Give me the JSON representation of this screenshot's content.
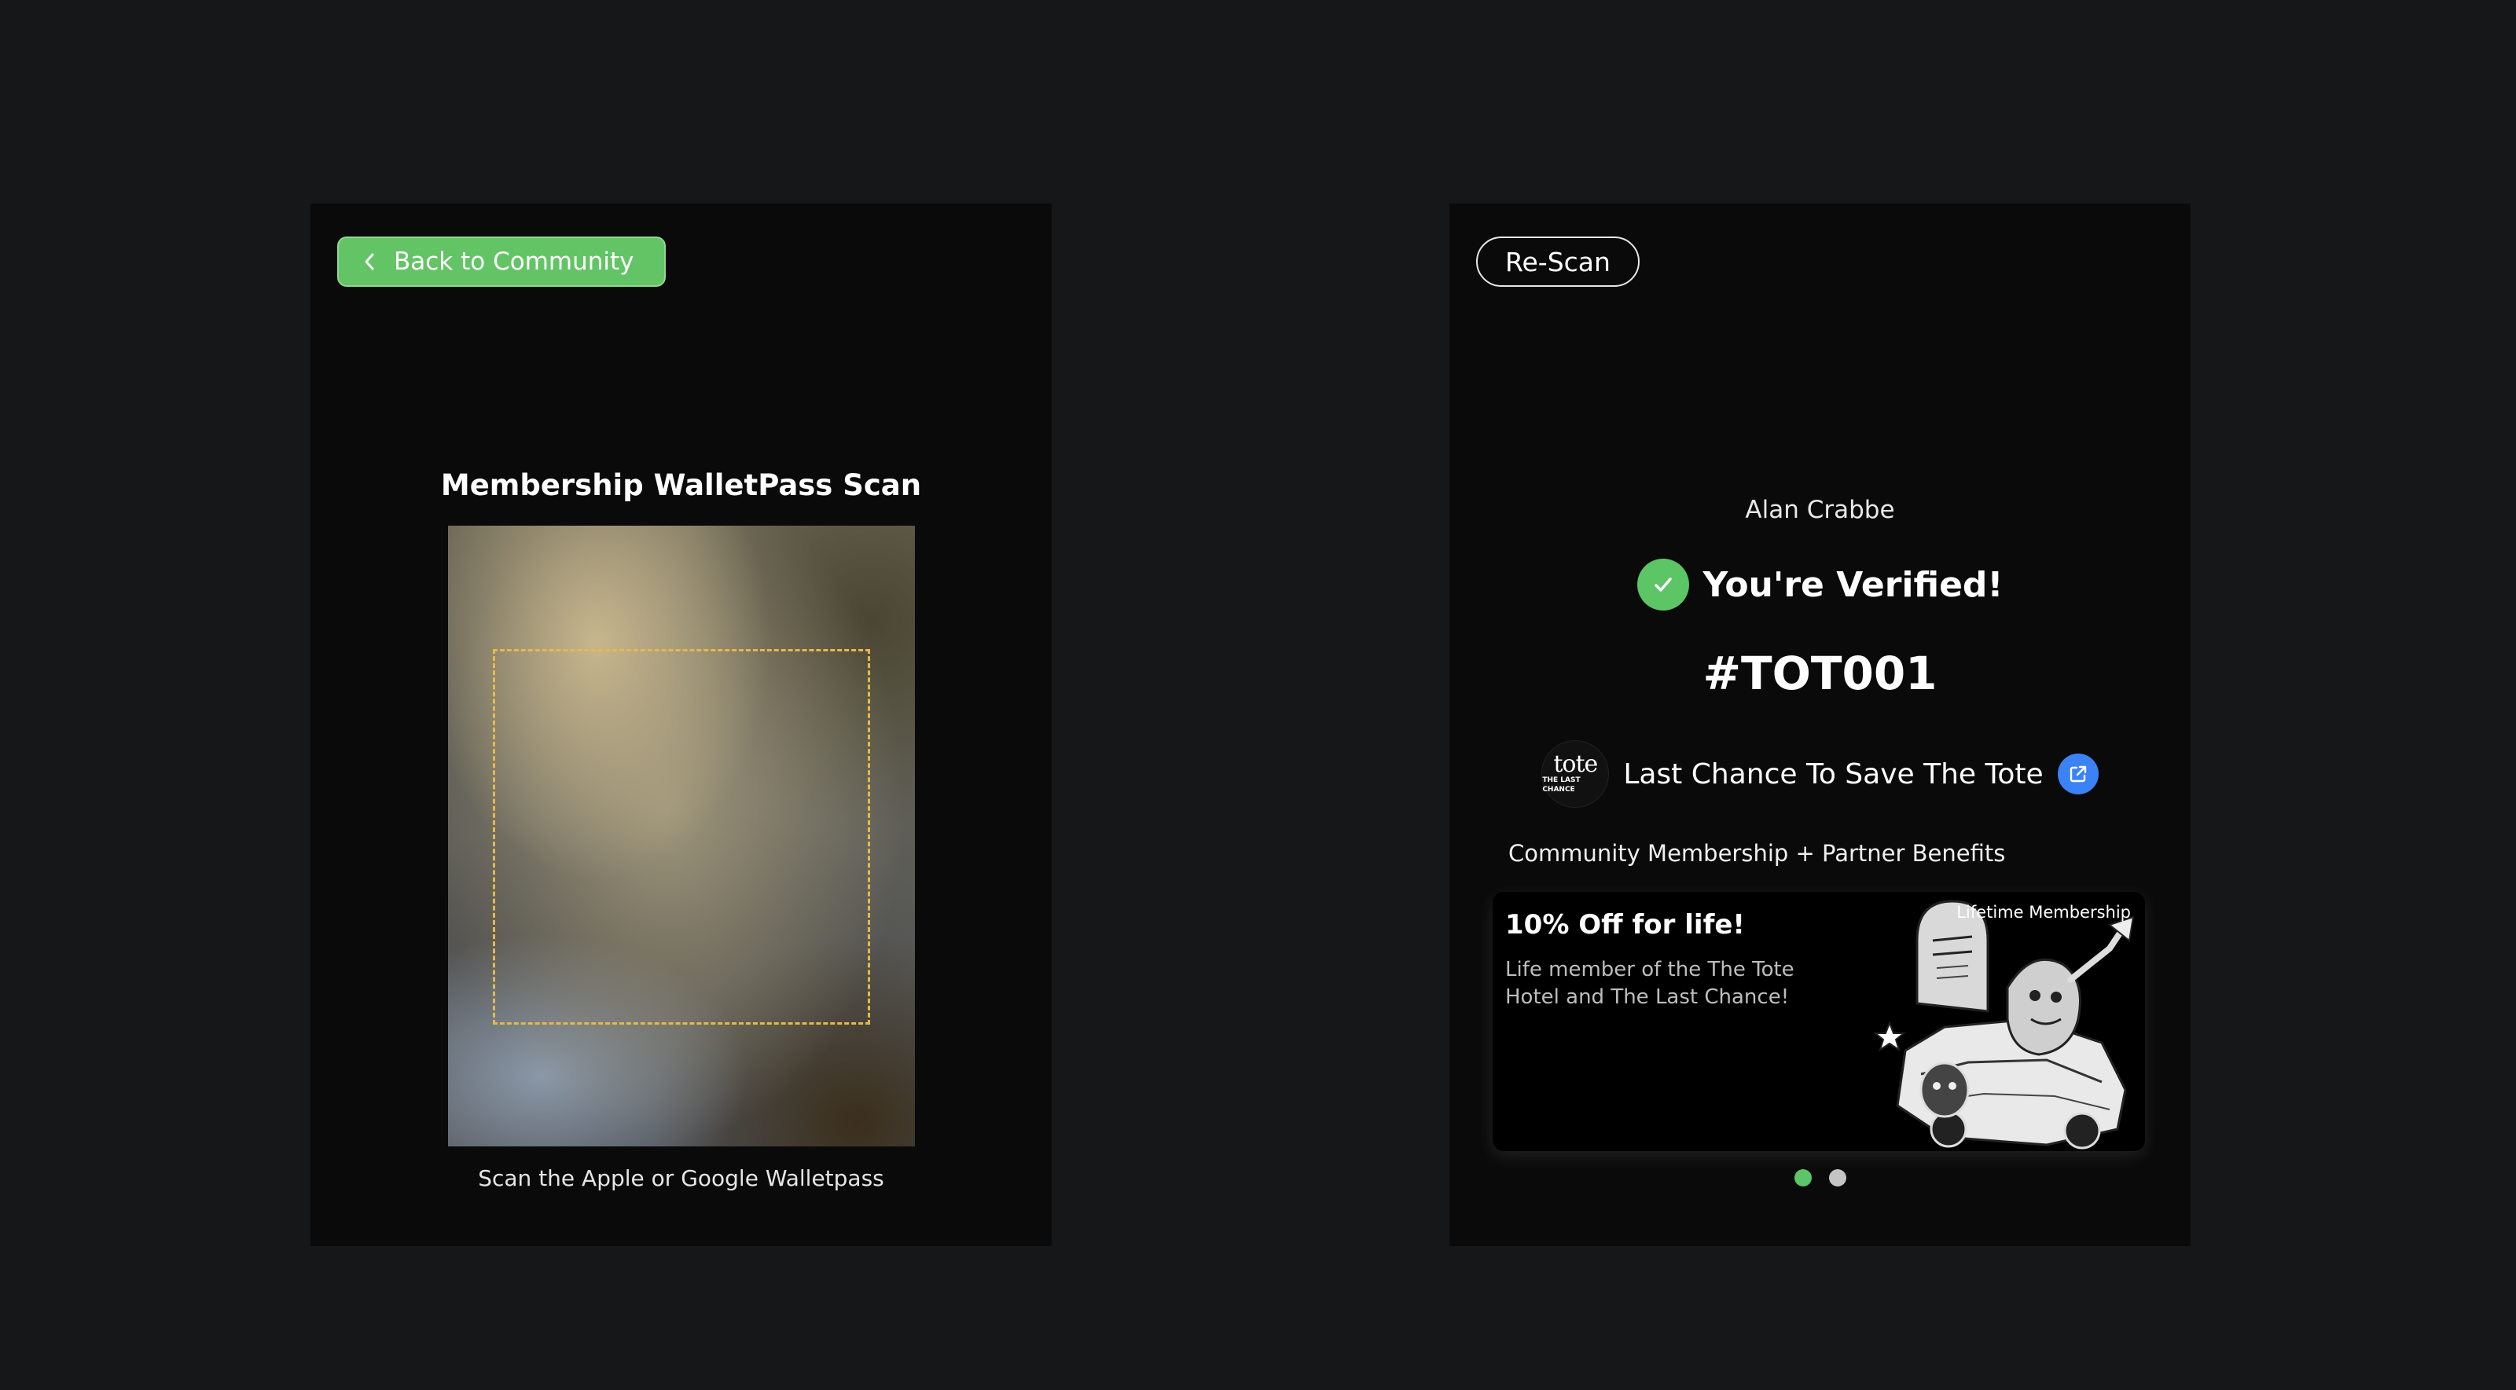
{
  "scan_screen": {
    "back_button_label": "Back to Community",
    "title": "Membership WalletPass Scan",
    "hint": "Scan the Apple or Google Walletpass",
    "accent_color": "#63c466",
    "scan_box_color": "#e8b84a"
  },
  "verified_screen": {
    "rescan_label": "Re-Scan",
    "member_name": "Alan Crabbe",
    "verified_text": "You're Verified!",
    "member_id": "#TOT001",
    "community": {
      "logo_main": "tote",
      "logo_sub": "THE LAST CHANCE",
      "name": "Last Chance To Save The Tote",
      "link_icon": "external-link-icon"
    },
    "benefits_label": "Community Membership + Partner Benefits",
    "benefit_card": {
      "title": "10% Off for life!",
      "description": "Life member of the The Tote Hotel and The Last Chance!",
      "badge": "Lifetime Membership",
      "art_icon": "tombstone-illustration"
    },
    "carousel": {
      "total": 2,
      "active_index": 0
    },
    "colors": {
      "verified": "#5cc565",
      "link": "#3b82f6"
    }
  }
}
